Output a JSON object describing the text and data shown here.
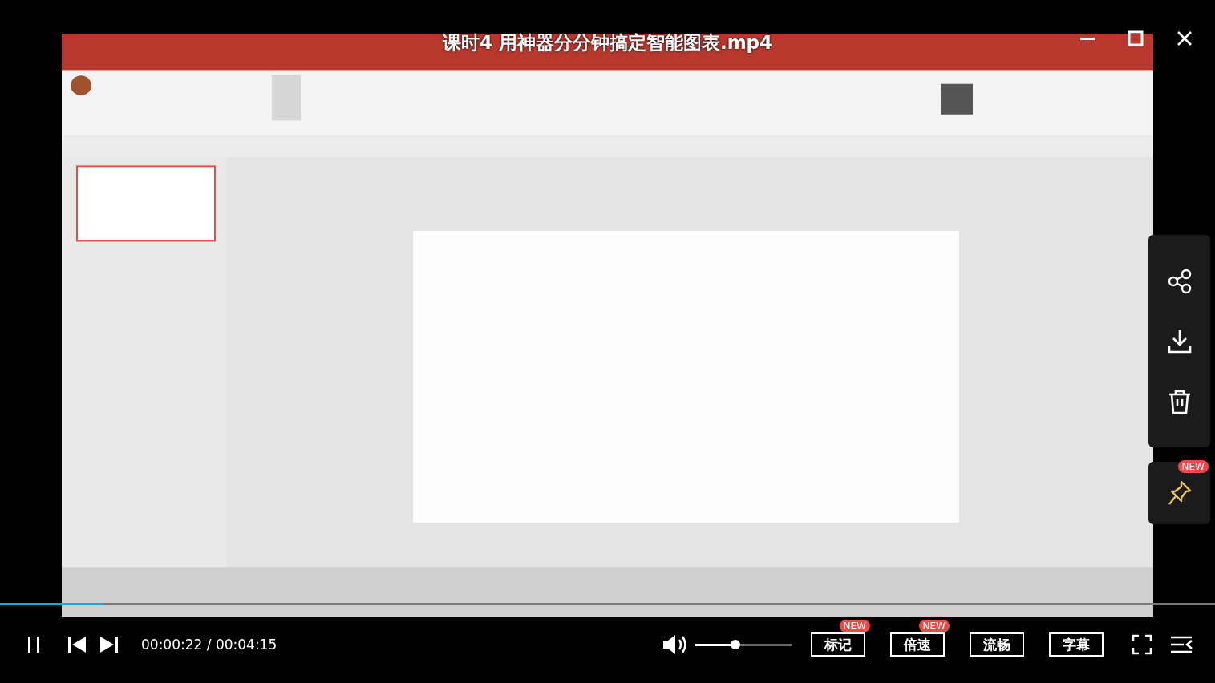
{
  "title": "课时4 用神器分分钟搞定智能图表.mp4",
  "pin": {
    "badge": "NEW"
  },
  "progress": {
    "level": 0.085
  },
  "player": {
    "playing": true,
    "time": "00:00:22 / 00:04:15",
    "volume": {
      "level": 0.42
    }
  },
  "buttons": [
    {
      "label": "标记",
      "badge": "NEW"
    },
    {
      "label": "倍速",
      "badge": "NEW"
    },
    {
      "label": "流畅"
    },
    {
      "label": "字幕"
    }
  ]
}
